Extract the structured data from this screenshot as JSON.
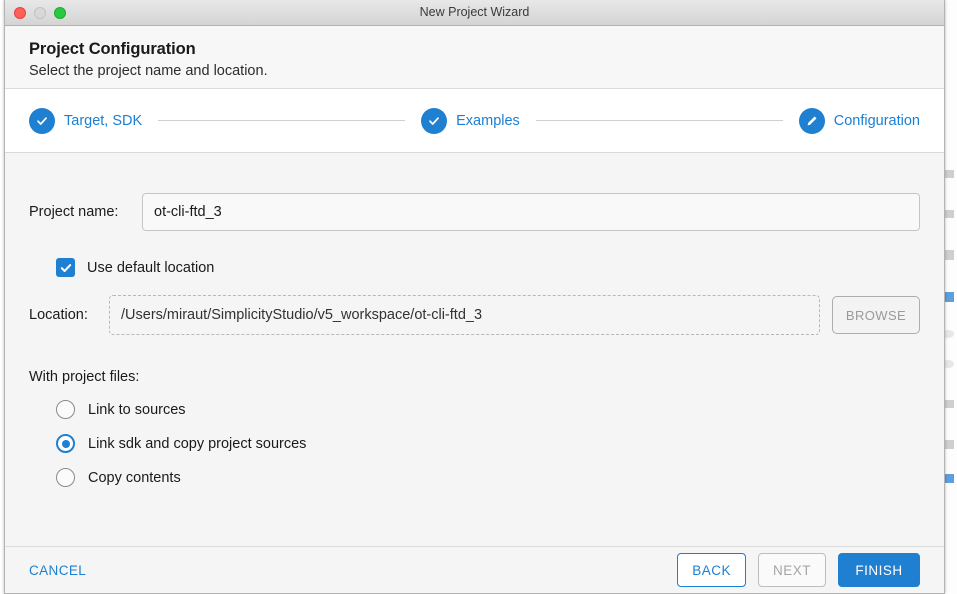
{
  "window": {
    "title": "New Project Wizard",
    "traffic_lights": [
      "close-button",
      "minimize-button",
      "zoom-button"
    ]
  },
  "header": {
    "title": "Project Configuration",
    "subtitle": "Select the project name and location."
  },
  "steps": [
    {
      "label": "Target, SDK",
      "state": "completed",
      "icon": "check-icon"
    },
    {
      "label": "Examples",
      "state": "completed",
      "icon": "check-icon"
    },
    {
      "label": "Configuration",
      "state": "current",
      "icon": "pencil-icon"
    }
  ],
  "form": {
    "project_name": {
      "label": "Project name:",
      "value": "ot-cli-ftd_3",
      "placeholder": ""
    },
    "use_default_location": {
      "label": "Use default location",
      "checked": true,
      "icon": "checkmark-icon"
    },
    "location": {
      "label": "Location:",
      "value": "/Users/miraut/SimplicityStudio/v5_workspace/ot-cli-ftd_3",
      "placeholder": "",
      "disabled": true
    },
    "browse_button": {
      "label": "BROWSE",
      "disabled": true
    },
    "project_files": {
      "title": "With project files:",
      "selected_index": 1,
      "options": [
        {
          "label": "Link to sources",
          "selected": false
        },
        {
          "label": "Link sdk and copy project sources",
          "selected": true
        },
        {
          "label": "Copy contents",
          "selected": false
        }
      ]
    }
  },
  "footer": {
    "cancel_label": "CANCEL",
    "back_label": "BACK",
    "next_label": "NEXT",
    "finish_label": "FINISH"
  },
  "colors": {
    "accent": "#1f7fd1",
    "link": "#1b7fd4",
    "disabled_text": "#a5a5a5",
    "panel_bg": "#f5f5f5",
    "white": "#ffffff"
  }
}
